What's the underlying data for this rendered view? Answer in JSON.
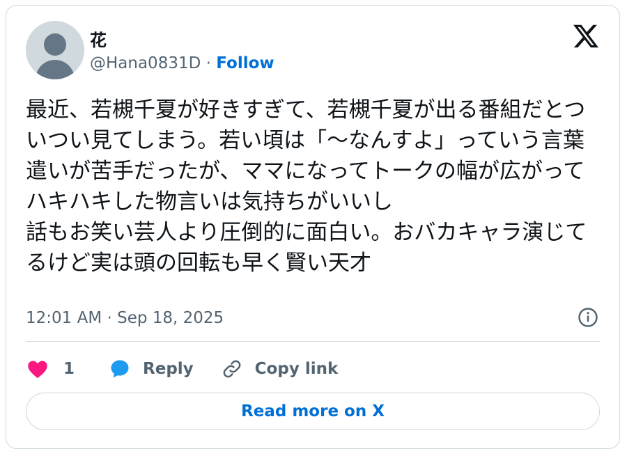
{
  "user": {
    "display_name": "花",
    "handle": "@Hana0831D",
    "separator": " · ",
    "follow_label": "Follow"
  },
  "tweet": {
    "text": "最近、若槻千夏が好きすぎて、若槻千夏が出る番組だとついつい見てしまう。若い頃は「〜なんすよ」っていう言葉遣いが苦手だったが、ママになってトークの幅が広がってハキハキした物言いは気持ちがいいし\n話もお笑い芸人より圧倒的に面白い。おバカキャラ演じてるけど実は頭の回転も早く賢い天才",
    "timestamp": "12:01 AM · Sep 18, 2025"
  },
  "actions": {
    "like_count": "1",
    "reply_label": "Reply",
    "copy_link_label": "Copy link"
  },
  "footer": {
    "read_more_label": "Read more on X"
  },
  "icons": {
    "like": "heart-icon",
    "reply": "speech-bubble-icon",
    "copy": "link-icon",
    "brand": "x-logo-icon",
    "info": "info-icon"
  },
  "colors": {
    "link_blue": "#006fd6",
    "heart_pink": "#f91880",
    "reply_blue": "#1d9bf0",
    "text": "#0f1419",
    "muted": "#536471",
    "border": "#cfd9de"
  }
}
